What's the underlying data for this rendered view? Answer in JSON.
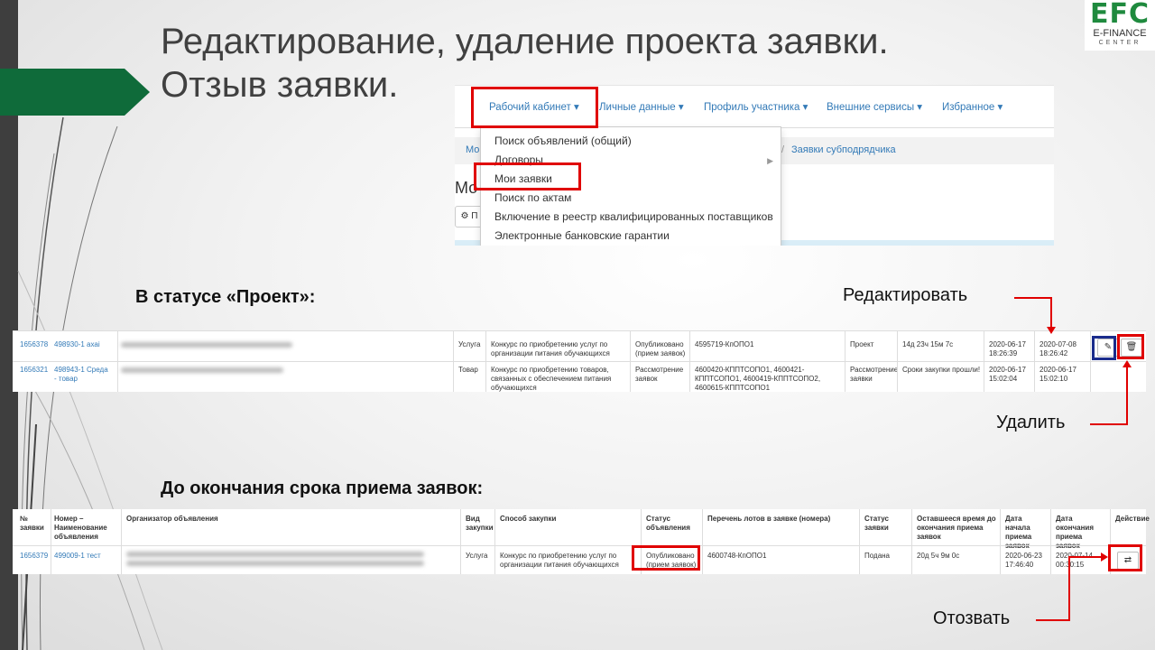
{
  "slide": {
    "title_line1": "Редактирование, удаление проекта заявки.",
    "title_line2": "Отзыв заявки.",
    "logo": {
      "big": "EFC",
      "sub": "E-FINANCE",
      "center": "CENTER"
    },
    "colors": {
      "accent_green": "#0f6b3a",
      "highlight_red": "#e00000",
      "link_blue": "#337ab7"
    }
  },
  "navbar": {
    "items": [
      "Рабочий кабинет ▾",
      "Личные данные ▾",
      "Профиль участника ▾",
      "Внешние сервисы ▾",
      "Избранное ▾"
    ],
    "breadcrumb": [
      "Мо",
      "Заявки субподрядчика"
    ],
    "page_heading": "Мо",
    "button_text": "⚙ П",
    "dropdown": [
      "Поиск объявлений (общий)",
      "Договоры",
      "Мои заявки",
      "Поиск по актам",
      "Включение в реестр квалифицированных поставщиков",
      "Электронные банковские гарантии"
    ]
  },
  "section1": {
    "label": "В статусе «Проект»:"
  },
  "table1": {
    "rows": [
      {
        "num": "1656378",
        "name": "498930-1 ахаі",
        "type": "Услуга",
        "method": "Конкурс по приобретению услуг по организации питания обучающихся",
        "ann_status": "Опубликовано (прием заявок)",
        "lots": "4595719-КпОПО1",
        "status": "Проект",
        "remaining": "14д 23ч 15м 7с",
        "start": "2020-06-17 18:26:39",
        "end": "2020-07-08 18:26:42"
      },
      {
        "num": "1656321",
        "name": "498943-1 Среда - товар",
        "type": "Товар",
        "method": "Конкурс по приобретению товаров, связанных с обеспечением питания обучающихся",
        "ann_status": "Рассмотрение заявок",
        "lots": "4600420-КППТСОПО1, 4600421-КППТСОПО1, 4600419-КППТСОПО2, 4600615-КППТСОПО1",
        "status": "Рассмотрение заявки",
        "remaining": "Сроки закупки прошли!",
        "start": "2020-06-17 15:02:04",
        "end": "2020-06-17 15:02:10"
      }
    ],
    "edit_icon": "edit-icon",
    "delete_icon": "trash-icon"
  },
  "callouts": {
    "edit": "Редактировать",
    "delete": "Удалить",
    "withdraw": "Отозвать"
  },
  "section2": {
    "label": "До окончания срока приема заявок:"
  },
  "table2": {
    "headers": [
      "№ заявки",
      "Номер – Наименование объявления",
      "Организатор объявления",
      "Вид закупки",
      "Способ закупки",
      "Статус объявления",
      "Перечень лотов в заявке (номера)",
      "Статус заявки",
      "Оставшееся время до окончания приема заявок",
      "Дата начала приема заявок",
      "Дата окончания приема заявок",
      "Действие"
    ],
    "row": {
      "num": "1656379",
      "name": "499009-1 тест",
      "type": "Услуга",
      "method": "Конкурс по приобретению услуг по организации питания обучающихся",
      "ann_status": "Опубликовано (прием заявок)",
      "lots": "4600748-КпОПО1",
      "status": "Подана",
      "remaining": "20д 5ч 9м 0с",
      "start": "2020-06-23 17:46:40",
      "end": "2020-07-14 00:30:15"
    },
    "withdraw_icon": "swap-icon"
  }
}
